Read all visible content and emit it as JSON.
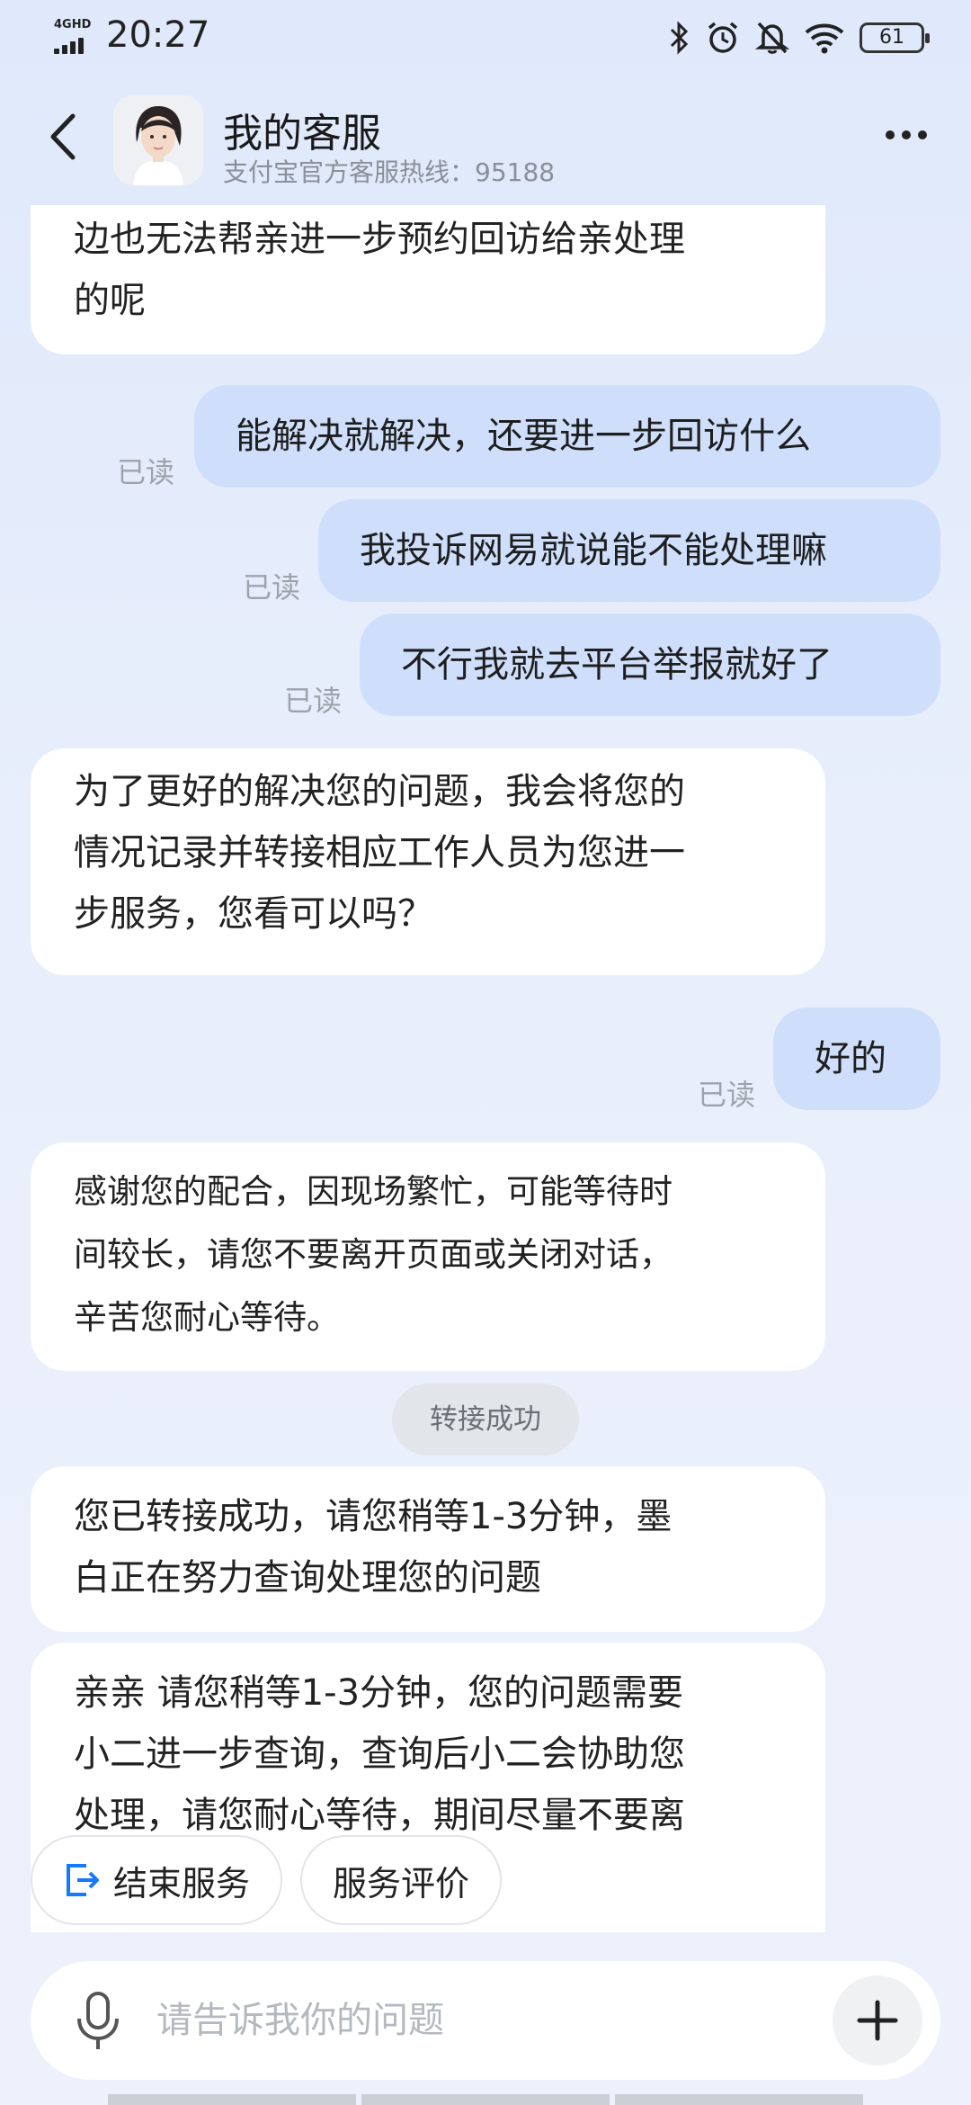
{
  "status_bar": {
    "network": "4GHD",
    "time": "20:27",
    "battery": "61",
    "icons": [
      "bluetooth-icon",
      "alarm-icon",
      "mute-bell-icon",
      "wifi-icon",
      "battery-icon"
    ]
  },
  "header": {
    "title": "我的客服",
    "subtitle": "支付宝官方客服热线：95188",
    "icons": [
      "back-arrow-icon",
      "avatar",
      "more-dots-icon"
    ]
  },
  "messages": [
    {
      "from": "agent",
      "lines": [
        "边也无法帮亲进一步预约回访给亲处理",
        "的呢"
      ]
    },
    {
      "from": "user",
      "text": "能解决就解决，还要进一步回访什么",
      "read": "已读"
    },
    {
      "from": "user",
      "text": "我投诉网易就说能不能处理嘛",
      "read": "已读"
    },
    {
      "from": "user",
      "text": "不行我就去平台举报就好了",
      "read": "已读"
    },
    {
      "from": "agent",
      "lines": [
        "为了更好的解决您的问题，我会将您的",
        "情况记录并转接相应工作人员为您进一",
        "步服务，您看可以吗？"
      ]
    },
    {
      "from": "user",
      "text": "好的",
      "read": "已读"
    },
    {
      "from": "agent",
      "lines": [
        "感谢您的配合，因现场繁忙，可能等待时",
        "间较长，请您不要离开页面或关闭对话，",
        "辛苦您耐心等待。"
      ]
    },
    {
      "from": "system",
      "text": "转接成功"
    },
    {
      "from": "agent",
      "lines": [
        "您已转接成功，请您稍等1-3分钟，墨",
        "白正在努力查询处理您的问题"
      ]
    },
    {
      "from": "agent",
      "lines": [
        "亲亲 请您稍等1-3分钟，您的问题需要",
        "小二进一步查询，查询后小二会协助您",
        "处理，请您耐心等待，期间尽量不要离"
      ]
    }
  ],
  "quick_actions": [
    {
      "label": "结束服务",
      "icon": "exit-icon"
    },
    {
      "label": "服务评价"
    }
  ],
  "input": {
    "placeholder": "请告诉我你的问题",
    "value": ""
  },
  "colors": {
    "user_bubble": "#cfdffb",
    "agent_bubble": "#ffffff",
    "accent": "#1677ff",
    "read_text": "#9ea3ab"
  }
}
